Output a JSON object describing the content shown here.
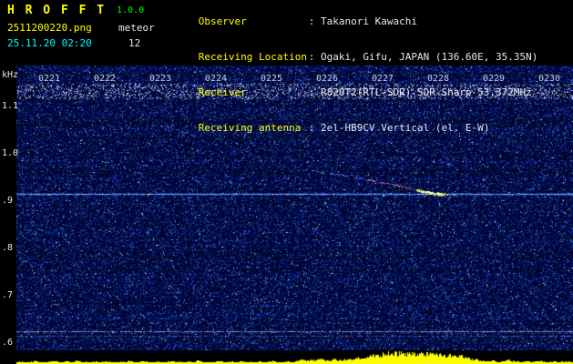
{
  "header": {
    "app_name": "H R O F F T",
    "version": "1.0.0",
    "filename": "2511200220.png",
    "mode": "meteor",
    "datetime": "25.11.20 02:20",
    "count": "12",
    "info": [
      {
        "label": "Observer",
        "value": ": Takanori Kawachi"
      },
      {
        "label": "Receiving Location",
        "value": ": Ogaki, Gifu, JAPAN (136.60E, 35.35N)"
      },
      {
        "label": "Receiver",
        "value": ": R820T2(RTL-SDR) SDR-Sharp 53.372MHz"
      },
      {
        "label": "Receiving antenna",
        "value": ": 2el-HB9CV Vertical (el. E-W)"
      }
    ]
  },
  "chart_data": {
    "type": "heatmap",
    "title": "HROFFT radio meteor spectrogram, 10-minute strip starting 02:20",
    "x_tick_labels": [
      "0221",
      "0222",
      "0223",
      "0224",
      "0225",
      "0226",
      "0227",
      "0228",
      "0229",
      "0230"
    ],
    "y_axis_label": "kHz",
    "y_tick_labels": [
      "1.1",
      "1.0",
      ".9",
      ".8",
      ".7",
      ".6"
    ],
    "y_tick_khz": [
      1.1,
      1.0,
      0.9,
      0.8,
      0.7,
      0.6
    ],
    "y_range_khz": [
      0.58,
      1.17
    ],
    "carrier_line_khz": 0.917,
    "faint_lines_khz": [
      0.627,
      0.617
    ],
    "noise_band_khz": [
      1.12,
      1.15
    ],
    "meteor_echo": {
      "description": "descending meteor head echo merging into carrier line",
      "start_time": "0225.6",
      "end_time": "0228.1",
      "start_khz": 0.969,
      "end_khz": 0.918,
      "points_min_khz": [
        [
          5.56,
          0.969
        ],
        [
          6.0,
          0.962
        ],
        [
          6.5,
          0.953
        ],
        [
          6.9,
          0.944
        ],
        [
          7.3,
          0.934
        ],
        [
          7.65,
          0.925
        ],
        [
          7.9,
          0.92
        ],
        [
          8.1,
          0.918
        ]
      ]
    },
    "scatter_dots": [
      {
        "min": 5.95,
        "khz": 0.9,
        "color": "#22dd55"
      },
      {
        "min": 7.0,
        "khz": 0.915,
        "color": "#33ff66"
      }
    ],
    "power_plot": {
      "color": "#ffff00",
      "peak_time": "0227.4",
      "values": [
        0.1,
        0.15,
        0.08,
        0.12,
        0.2,
        0.1,
        0.07,
        0.14,
        0.22,
        0.09,
        0.12,
        0.18,
        0.1,
        0.25,
        0.08,
        0.13,
        0.1,
        0.16,
        0.09,
        0.2,
        0.11,
        0.08,
        0.15,
        0.1,
        0.22,
        0.12,
        0.09,
        0.18,
        0.13,
        0.1,
        0.16,
        0.08,
        0.12,
        0.2,
        0.1,
        0.14,
        0.09,
        0.17,
        0.11,
        0.25,
        0.1,
        0.13,
        0.08,
        0.19,
        0.12,
        0.1,
        0.15,
        0.09,
        0.21,
        0.11,
        0.14,
        0.1,
        0.18,
        0.08,
        0.13,
        0.22,
        0.1,
        0.12,
        0.16,
        0.09,
        0.2,
        0.3,
        0.22,
        0.35,
        0.25,
        0.4,
        0.3,
        0.26,
        0.38,
        0.28,
        0.35,
        0.45,
        0.38,
        0.5,
        0.55,
        0.65,
        0.75,
        0.7,
        0.85,
        1.0,
        0.9,
        0.95,
        1.0,
        0.88,
        1.0,
        0.92,
        0.85,
        0.95,
        1.0,
        0.9,
        0.8,
        0.92,
        0.75,
        0.85,
        0.65,
        0.7,
        0.55,
        0.45,
        0.38,
        0.3,
        0.22,
        0.16,
        0.25,
        0.12,
        0.18,
        0.3,
        0.2,
        0.14,
        0.1,
        0.22,
        0.13,
        0.16,
        0.24,
        0.1,
        0.15,
        0.2,
        0.11,
        0.13,
        0.18,
        0.1
      ]
    },
    "colors": {
      "background": "#000000",
      "noise_base": "#00001e",
      "carrier": "#4f8cff",
      "power": "#ffff00"
    }
  }
}
